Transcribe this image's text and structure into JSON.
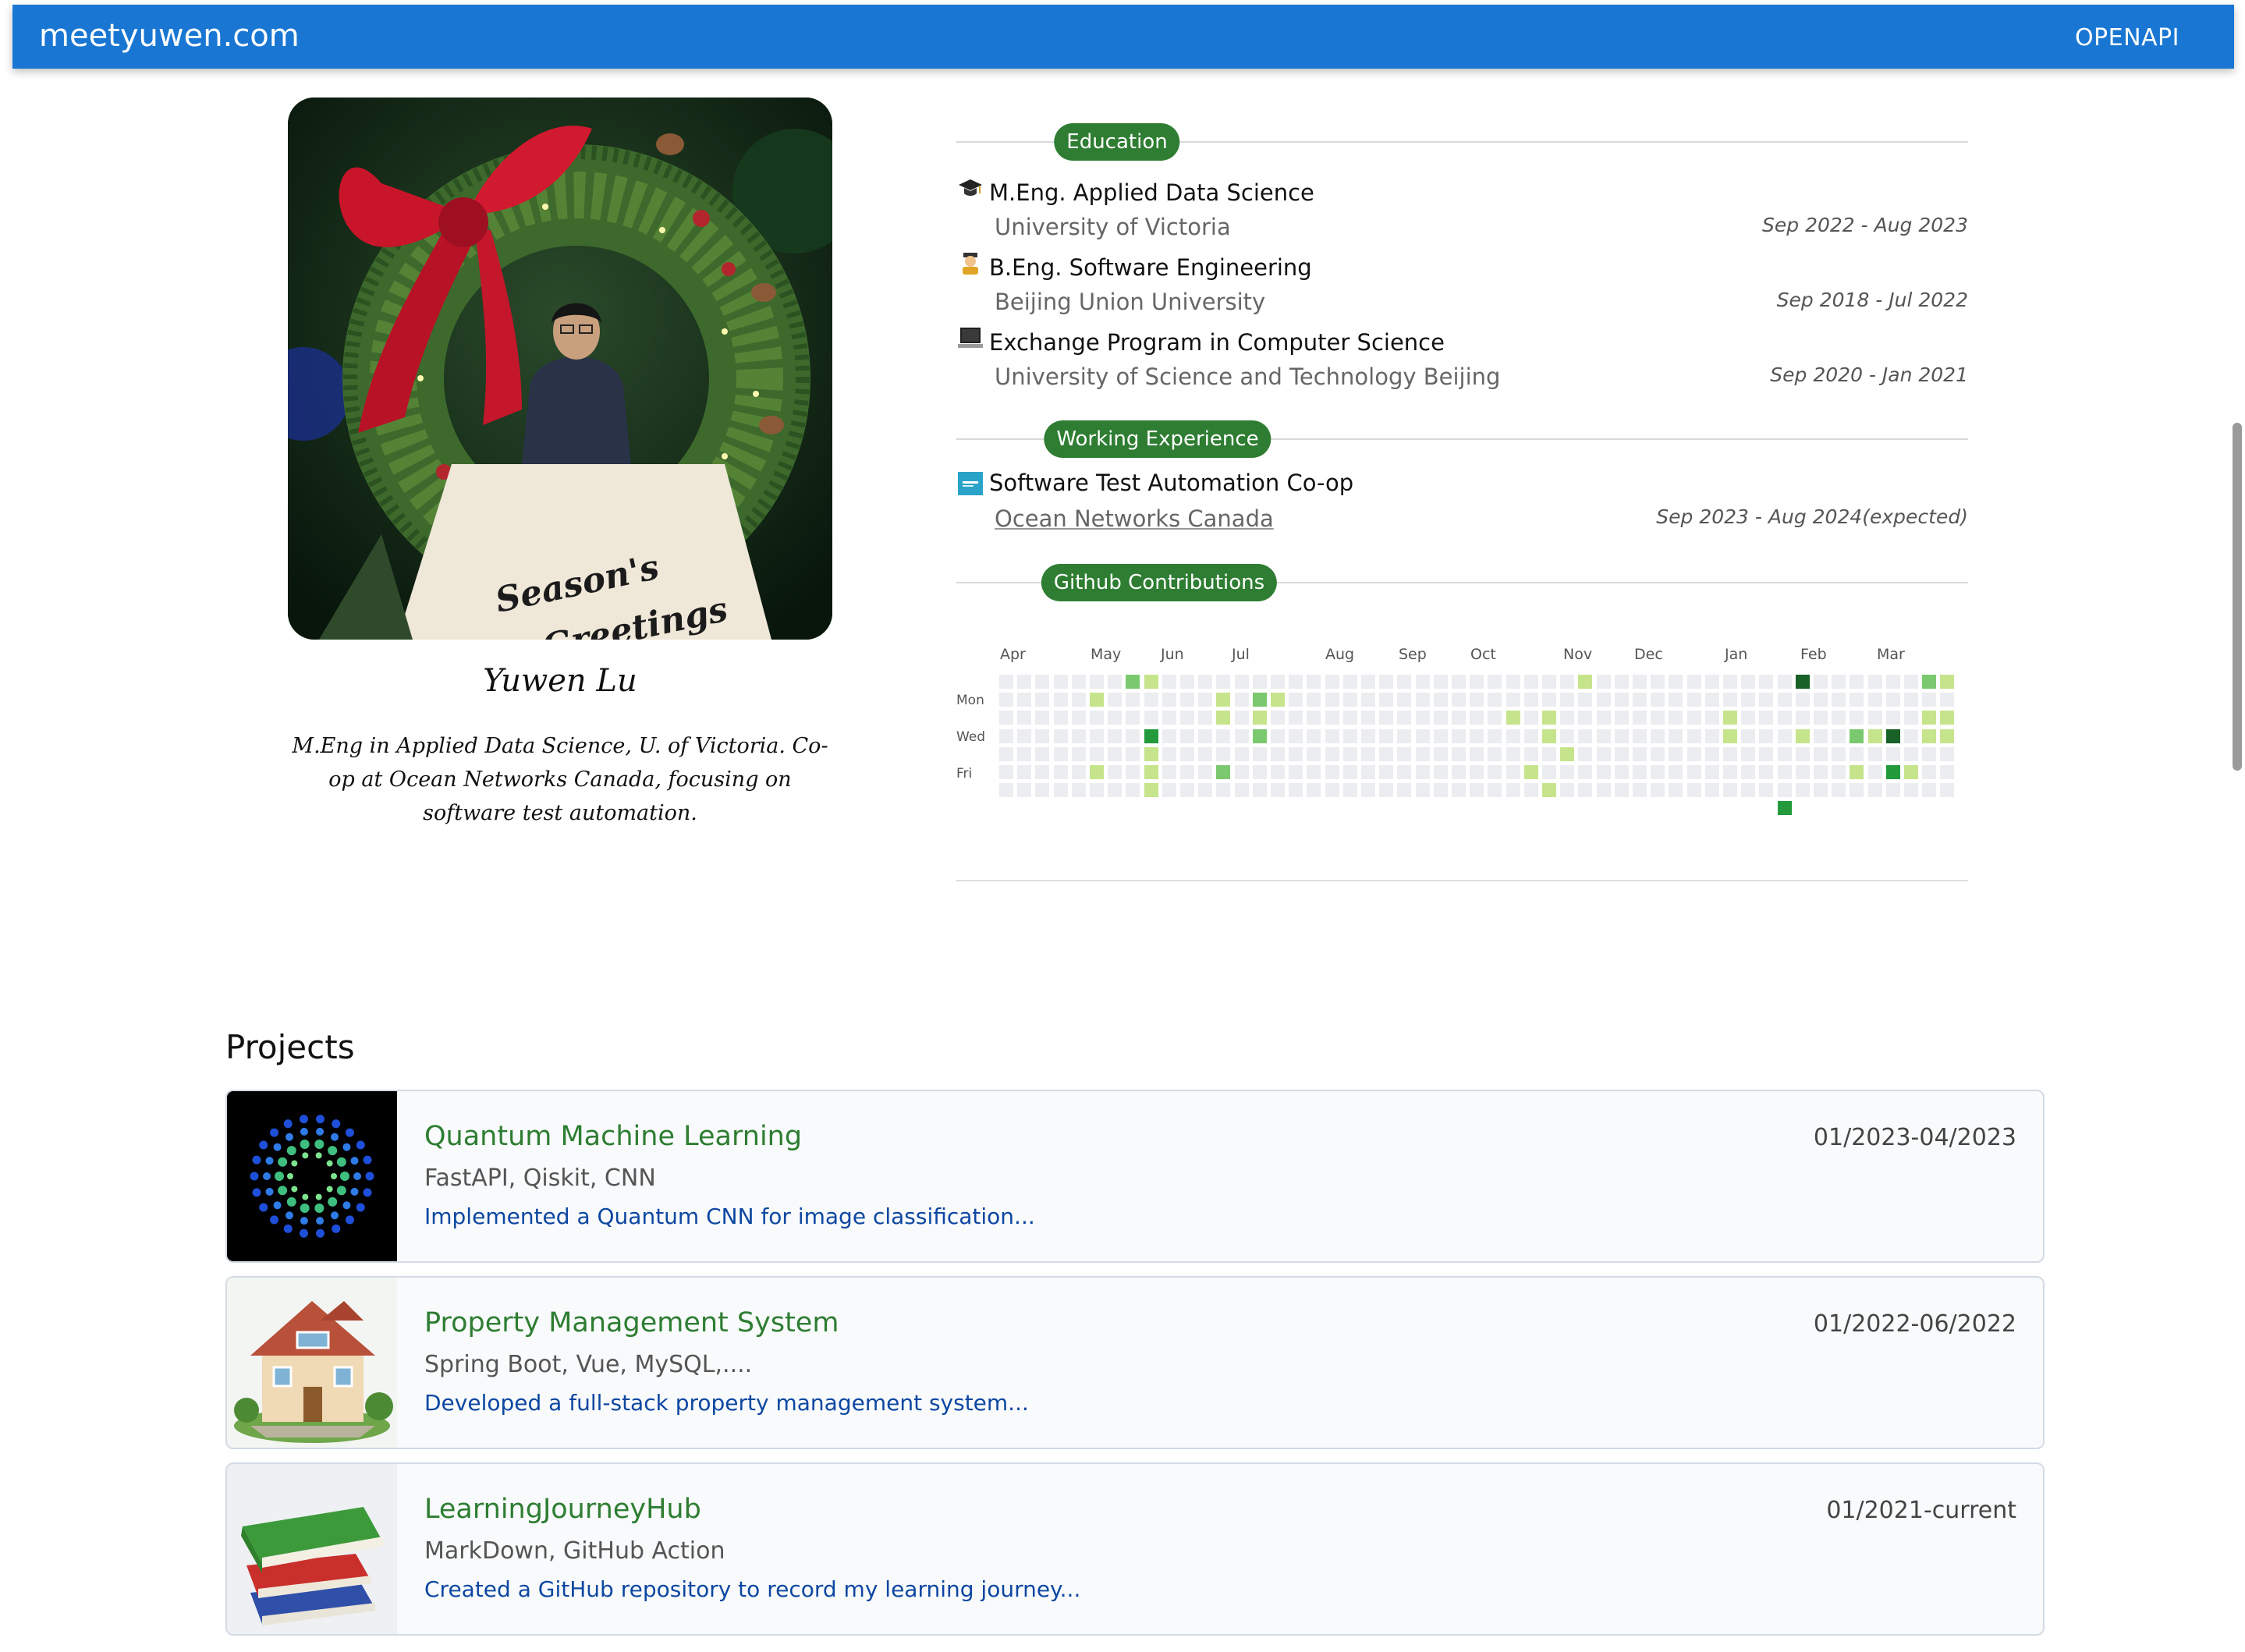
{
  "header": {
    "brand": "meetyuwen.com",
    "nav_link": "OPENAPI",
    "color": "#1976d2"
  },
  "profile": {
    "photo_sign_text": "Season's Greetings",
    "name": "Yuwen Lu",
    "bio": "M.Eng in Applied Data Science, U. of Victoria. Co-op at Ocean Networks Canada, focusing on software test automation."
  },
  "education": {
    "heading": "Education",
    "entries": [
      {
        "icon": "graduation-cap-icon",
        "title": "M.Eng. Applied Data Science",
        "institution": "University of Victoria",
        "dates": "Sep 2022 - Aug 2023"
      },
      {
        "icon": "student-icon",
        "title": "B.Eng. Software Engineering",
        "institution": "Beijing Union University",
        "dates": "Sep 2018 - Jul 2022"
      },
      {
        "icon": "laptop-icon",
        "title": "Exchange Program in Computer Science",
        "institution": "University of Science and Technology Beijing",
        "dates": "Sep 2020 - Jan 2021"
      }
    ]
  },
  "experience": {
    "heading": "Working Experience",
    "entries": [
      {
        "icon": "company-logo-icon",
        "title": "Software Test Automation Co-op",
        "company": "Ocean Networks Canada",
        "dates": "Sep 2023 - Aug 2024(expected)"
      }
    ]
  },
  "contributions": {
    "heading": "Github Contributions",
    "months": [
      "Apr",
      "May",
      "Jun",
      "Jul",
      "Aug",
      "Sep",
      "Oct",
      "Nov",
      "Dec",
      "Jan",
      "Feb",
      "Mar"
    ],
    "day_labels": [
      "Mon",
      "Wed",
      "Fri"
    ],
    "weeks": 53,
    "level_colors": [
      "#ebedf0",
      "#c6e48b",
      "#7bc96f",
      "#239a3b",
      "#196127"
    ],
    "active_days": [
      {
        "week": 7,
        "day": 0,
        "level": 2
      },
      {
        "week": 8,
        "day": 0,
        "level": 1
      },
      {
        "week": 5,
        "day": 1,
        "level": 1
      },
      {
        "week": 12,
        "day": 1,
        "level": 1
      },
      {
        "week": 14,
        "day": 1,
        "level": 2
      },
      {
        "week": 15,
        "day": 1,
        "level": 1
      },
      {
        "week": 12,
        "day": 2,
        "level": 1
      },
      {
        "week": 14,
        "day": 2,
        "level": 1
      },
      {
        "week": 8,
        "day": 3,
        "level": 3
      },
      {
        "week": 14,
        "day": 3,
        "level": 2
      },
      {
        "week": 8,
        "day": 4,
        "level": 1
      },
      {
        "week": 8,
        "day": 5,
        "level": 1
      },
      {
        "week": 5,
        "day": 5,
        "level": 1
      },
      {
        "week": 12,
        "day": 5,
        "level": 2
      },
      {
        "week": 8,
        "day": 6,
        "level": 1
      },
      {
        "week": 32,
        "day": 0,
        "level": 1
      },
      {
        "week": 28,
        "day": 2,
        "level": 1
      },
      {
        "week": 30,
        "day": 2,
        "level": 1
      },
      {
        "week": 30,
        "day": 3,
        "level": 1
      },
      {
        "week": 31,
        "day": 4,
        "level": 1
      },
      {
        "week": 29,
        "day": 5,
        "level": 1
      },
      {
        "week": 30,
        "day": 6,
        "level": 1
      },
      {
        "week": 40,
        "day": 2,
        "level": 1
      },
      {
        "week": 40,
        "day": 3,
        "level": 1
      },
      {
        "week": 44,
        "day": 0,
        "level": 4
      },
      {
        "week": 44,
        "day": 3,
        "level": 1
      },
      {
        "week": 43,
        "day": 7,
        "level": 3
      },
      {
        "week": 47,
        "day": 3,
        "level": 2
      },
      {
        "week": 48,
        "day": 3,
        "level": 1
      },
      {
        "week": 49,
        "day": 3,
        "level": 4
      },
      {
        "week": 47,
        "day": 5,
        "level": 1
      },
      {
        "week": 49,
        "day": 5,
        "level": 3
      },
      {
        "week": 50,
        "day": 5,
        "level": 1
      },
      {
        "week": 51,
        "day": 0,
        "level": 2
      },
      {
        "week": 52,
        "day": 0,
        "level": 1
      },
      {
        "week": 51,
        "day": 2,
        "level": 1
      },
      {
        "week": 52,
        "day": 2,
        "level": 1
      },
      {
        "week": 51,
        "day": 3,
        "level": 1
      },
      {
        "week": 52,
        "day": 3,
        "level": 1
      }
    ]
  },
  "projects": {
    "heading": "Projects",
    "items": [
      {
        "thumb": "quantum-dots-thumbnail",
        "title": "Quantum Machine Learning",
        "tech": "FastAPI, Qiskit, CNN",
        "description": "Implemented a Quantum CNN for image classification...",
        "dates": "01/2023-04/2023"
      },
      {
        "thumb": "house-thumbnail",
        "title": "Property Management System",
        "tech": "Spring Boot, Vue, MySQL,....",
        "description": "Developed a full-stack property management system...",
        "dates": "01/2022-06/2022"
      },
      {
        "thumb": "books-thumbnail",
        "title": "LearningJourneyHub",
        "tech": "MarkDown, GitHub Action",
        "description": "Created a GitHub repository to record my learning journey...",
        "dates": "01/2021-current"
      }
    ]
  }
}
